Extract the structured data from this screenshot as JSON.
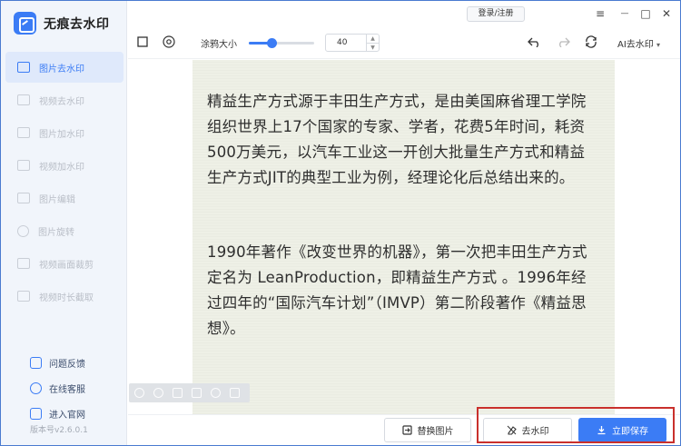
{
  "app": {
    "name": "无痕去水印",
    "version": "版本号v2.6.0.1"
  },
  "titlebar": {
    "login_label": "登录/注册",
    "menu_icon": "≡",
    "minimize_icon": "—",
    "maximize_icon": "□",
    "close_icon": "✕"
  },
  "sidebar": {
    "items": [
      {
        "label": "图片去水印",
        "active": true
      },
      {
        "label": "视频去水印"
      },
      {
        "label": "图片加水印"
      },
      {
        "label": "视频加水印"
      },
      {
        "label": "图片编辑"
      },
      {
        "label": "图片旋转"
      },
      {
        "label": "视频画面裁剪"
      },
      {
        "label": "视频时长截取"
      }
    ],
    "bottom": [
      {
        "label": "问题反馈"
      },
      {
        "label": "在线客服"
      },
      {
        "label": "进入官网"
      }
    ]
  },
  "toolbar": {
    "brush_label": "涂鸦大小",
    "brush_size": "40",
    "brush_fraction": 0.35,
    "ai_label": "AI去水印"
  },
  "document": {
    "paragraph1": "精益生产方式源于丰田生产方式，是由美国麻省理工学院组织世界上17个国家的专家、学者，花费5年时间，耗资500万美元，以汽车工业这一开创大批量生产方式和精益生产方式JIT的典型工业为例，经理论化后总结出来的。",
    "paragraph2": "1990年著作《改变世界的机器》，第一次把丰田生产方式定名为 LeanProduction，即精益生产方式 。1996年经过四年的“国际汽车计划”（IMVP）第二阶段著作《精益思想》。"
  },
  "bottombar": {
    "replace_label": "替换图片",
    "remove_label": "去水印",
    "save_label": "立即保存"
  },
  "colors": {
    "accent": "#3b7cf5",
    "highlight": "#c9302c"
  }
}
